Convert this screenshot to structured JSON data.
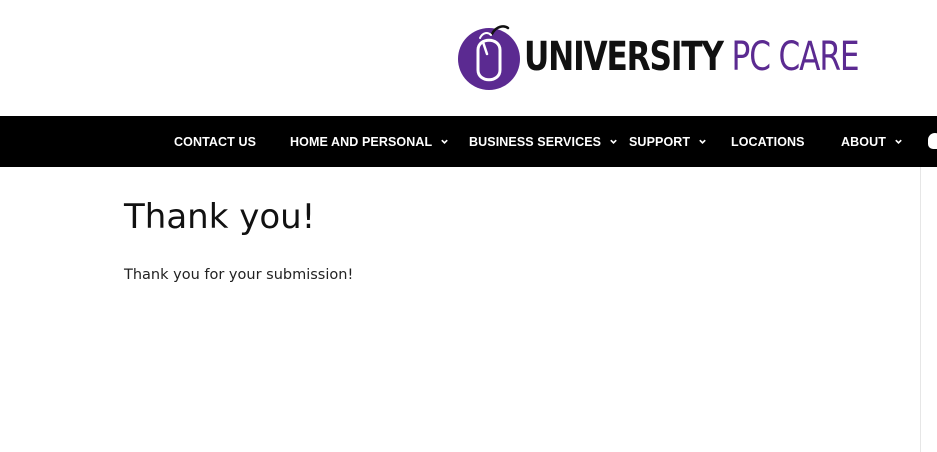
{
  "header": {
    "logo": {
      "word_1": "UNIVERSITY",
      "word_2": "PC CARE",
      "brand_color": "#5b2a91",
      "icon": "mouse-logo-icon"
    }
  },
  "nav": {
    "background": "#000000",
    "items": [
      {
        "label": "CONTACT US",
        "has_dropdown": false
      },
      {
        "label": "HOME AND PERSONAL",
        "has_dropdown": true
      },
      {
        "label": "BUSINESS SERVICES",
        "has_dropdown": true
      },
      {
        "label": "SUPPORT",
        "has_dropdown": true
      },
      {
        "label": "LOCATIONS",
        "has_dropdown": false
      },
      {
        "label": "ABOUT",
        "has_dropdown": true
      }
    ],
    "extra_icon": "apple-icon"
  },
  "main": {
    "title": "Thank you!",
    "message": "Thank you for your submission!"
  }
}
